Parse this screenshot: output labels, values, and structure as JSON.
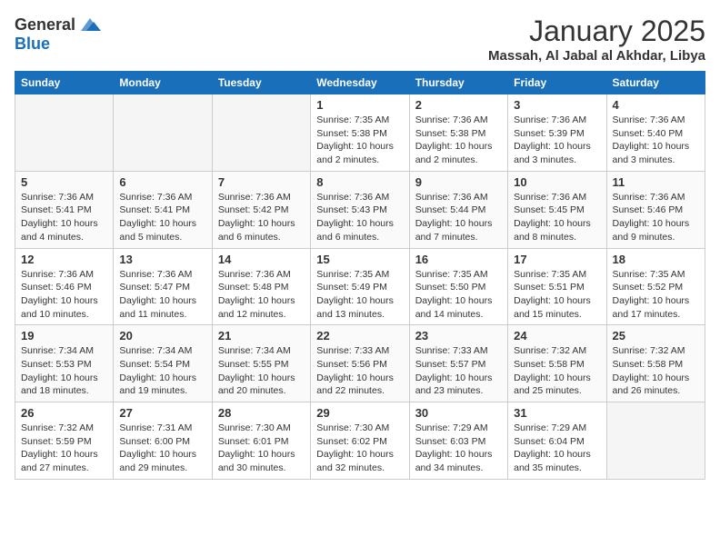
{
  "logo": {
    "general": "General",
    "blue": "Blue"
  },
  "title": "January 2025",
  "subtitle": "Massah, Al Jabal al Akhdar, Libya",
  "days_of_week": [
    "Sunday",
    "Monday",
    "Tuesday",
    "Wednesday",
    "Thursday",
    "Friday",
    "Saturday"
  ],
  "weeks": [
    [
      {
        "num": "",
        "sunrise": "",
        "sunset": "",
        "daylight": ""
      },
      {
        "num": "",
        "sunrise": "",
        "sunset": "",
        "daylight": ""
      },
      {
        "num": "",
        "sunrise": "",
        "sunset": "",
        "daylight": ""
      },
      {
        "num": "1",
        "sunrise": "Sunrise: 7:35 AM",
        "sunset": "Sunset: 5:38 PM",
        "daylight": "Daylight: 10 hours and 2 minutes."
      },
      {
        "num": "2",
        "sunrise": "Sunrise: 7:36 AM",
        "sunset": "Sunset: 5:38 PM",
        "daylight": "Daylight: 10 hours and 2 minutes."
      },
      {
        "num": "3",
        "sunrise": "Sunrise: 7:36 AM",
        "sunset": "Sunset: 5:39 PM",
        "daylight": "Daylight: 10 hours and 3 minutes."
      },
      {
        "num": "4",
        "sunrise": "Sunrise: 7:36 AM",
        "sunset": "Sunset: 5:40 PM",
        "daylight": "Daylight: 10 hours and 3 minutes."
      }
    ],
    [
      {
        "num": "5",
        "sunrise": "Sunrise: 7:36 AM",
        "sunset": "Sunset: 5:41 PM",
        "daylight": "Daylight: 10 hours and 4 minutes."
      },
      {
        "num": "6",
        "sunrise": "Sunrise: 7:36 AM",
        "sunset": "Sunset: 5:41 PM",
        "daylight": "Daylight: 10 hours and 5 minutes."
      },
      {
        "num": "7",
        "sunrise": "Sunrise: 7:36 AM",
        "sunset": "Sunset: 5:42 PM",
        "daylight": "Daylight: 10 hours and 6 minutes."
      },
      {
        "num": "8",
        "sunrise": "Sunrise: 7:36 AM",
        "sunset": "Sunset: 5:43 PM",
        "daylight": "Daylight: 10 hours and 6 minutes."
      },
      {
        "num": "9",
        "sunrise": "Sunrise: 7:36 AM",
        "sunset": "Sunset: 5:44 PM",
        "daylight": "Daylight: 10 hours and 7 minutes."
      },
      {
        "num": "10",
        "sunrise": "Sunrise: 7:36 AM",
        "sunset": "Sunset: 5:45 PM",
        "daylight": "Daylight: 10 hours and 8 minutes."
      },
      {
        "num": "11",
        "sunrise": "Sunrise: 7:36 AM",
        "sunset": "Sunset: 5:46 PM",
        "daylight": "Daylight: 10 hours and 9 minutes."
      }
    ],
    [
      {
        "num": "12",
        "sunrise": "Sunrise: 7:36 AM",
        "sunset": "Sunset: 5:46 PM",
        "daylight": "Daylight: 10 hours and 10 minutes."
      },
      {
        "num": "13",
        "sunrise": "Sunrise: 7:36 AM",
        "sunset": "Sunset: 5:47 PM",
        "daylight": "Daylight: 10 hours and 11 minutes."
      },
      {
        "num": "14",
        "sunrise": "Sunrise: 7:36 AM",
        "sunset": "Sunset: 5:48 PM",
        "daylight": "Daylight: 10 hours and 12 minutes."
      },
      {
        "num": "15",
        "sunrise": "Sunrise: 7:35 AM",
        "sunset": "Sunset: 5:49 PM",
        "daylight": "Daylight: 10 hours and 13 minutes."
      },
      {
        "num": "16",
        "sunrise": "Sunrise: 7:35 AM",
        "sunset": "Sunset: 5:50 PM",
        "daylight": "Daylight: 10 hours and 14 minutes."
      },
      {
        "num": "17",
        "sunrise": "Sunrise: 7:35 AM",
        "sunset": "Sunset: 5:51 PM",
        "daylight": "Daylight: 10 hours and 15 minutes."
      },
      {
        "num": "18",
        "sunrise": "Sunrise: 7:35 AM",
        "sunset": "Sunset: 5:52 PM",
        "daylight": "Daylight: 10 hours and 17 minutes."
      }
    ],
    [
      {
        "num": "19",
        "sunrise": "Sunrise: 7:34 AM",
        "sunset": "Sunset: 5:53 PM",
        "daylight": "Daylight: 10 hours and 18 minutes."
      },
      {
        "num": "20",
        "sunrise": "Sunrise: 7:34 AM",
        "sunset": "Sunset: 5:54 PM",
        "daylight": "Daylight: 10 hours and 19 minutes."
      },
      {
        "num": "21",
        "sunrise": "Sunrise: 7:34 AM",
        "sunset": "Sunset: 5:55 PM",
        "daylight": "Daylight: 10 hours and 20 minutes."
      },
      {
        "num": "22",
        "sunrise": "Sunrise: 7:33 AM",
        "sunset": "Sunset: 5:56 PM",
        "daylight": "Daylight: 10 hours and 22 minutes."
      },
      {
        "num": "23",
        "sunrise": "Sunrise: 7:33 AM",
        "sunset": "Sunset: 5:57 PM",
        "daylight": "Daylight: 10 hours and 23 minutes."
      },
      {
        "num": "24",
        "sunrise": "Sunrise: 7:32 AM",
        "sunset": "Sunset: 5:58 PM",
        "daylight": "Daylight: 10 hours and 25 minutes."
      },
      {
        "num": "25",
        "sunrise": "Sunrise: 7:32 AM",
        "sunset": "Sunset: 5:58 PM",
        "daylight": "Daylight: 10 hours and 26 minutes."
      }
    ],
    [
      {
        "num": "26",
        "sunrise": "Sunrise: 7:32 AM",
        "sunset": "Sunset: 5:59 PM",
        "daylight": "Daylight: 10 hours and 27 minutes."
      },
      {
        "num": "27",
        "sunrise": "Sunrise: 7:31 AM",
        "sunset": "Sunset: 6:00 PM",
        "daylight": "Daylight: 10 hours and 29 minutes."
      },
      {
        "num": "28",
        "sunrise": "Sunrise: 7:30 AM",
        "sunset": "Sunset: 6:01 PM",
        "daylight": "Daylight: 10 hours and 30 minutes."
      },
      {
        "num": "29",
        "sunrise": "Sunrise: 7:30 AM",
        "sunset": "Sunset: 6:02 PM",
        "daylight": "Daylight: 10 hours and 32 minutes."
      },
      {
        "num": "30",
        "sunrise": "Sunrise: 7:29 AM",
        "sunset": "Sunset: 6:03 PM",
        "daylight": "Daylight: 10 hours and 34 minutes."
      },
      {
        "num": "31",
        "sunrise": "Sunrise: 7:29 AM",
        "sunset": "Sunset: 6:04 PM",
        "daylight": "Daylight: 10 hours and 35 minutes."
      },
      {
        "num": "",
        "sunrise": "",
        "sunset": "",
        "daylight": ""
      }
    ]
  ]
}
